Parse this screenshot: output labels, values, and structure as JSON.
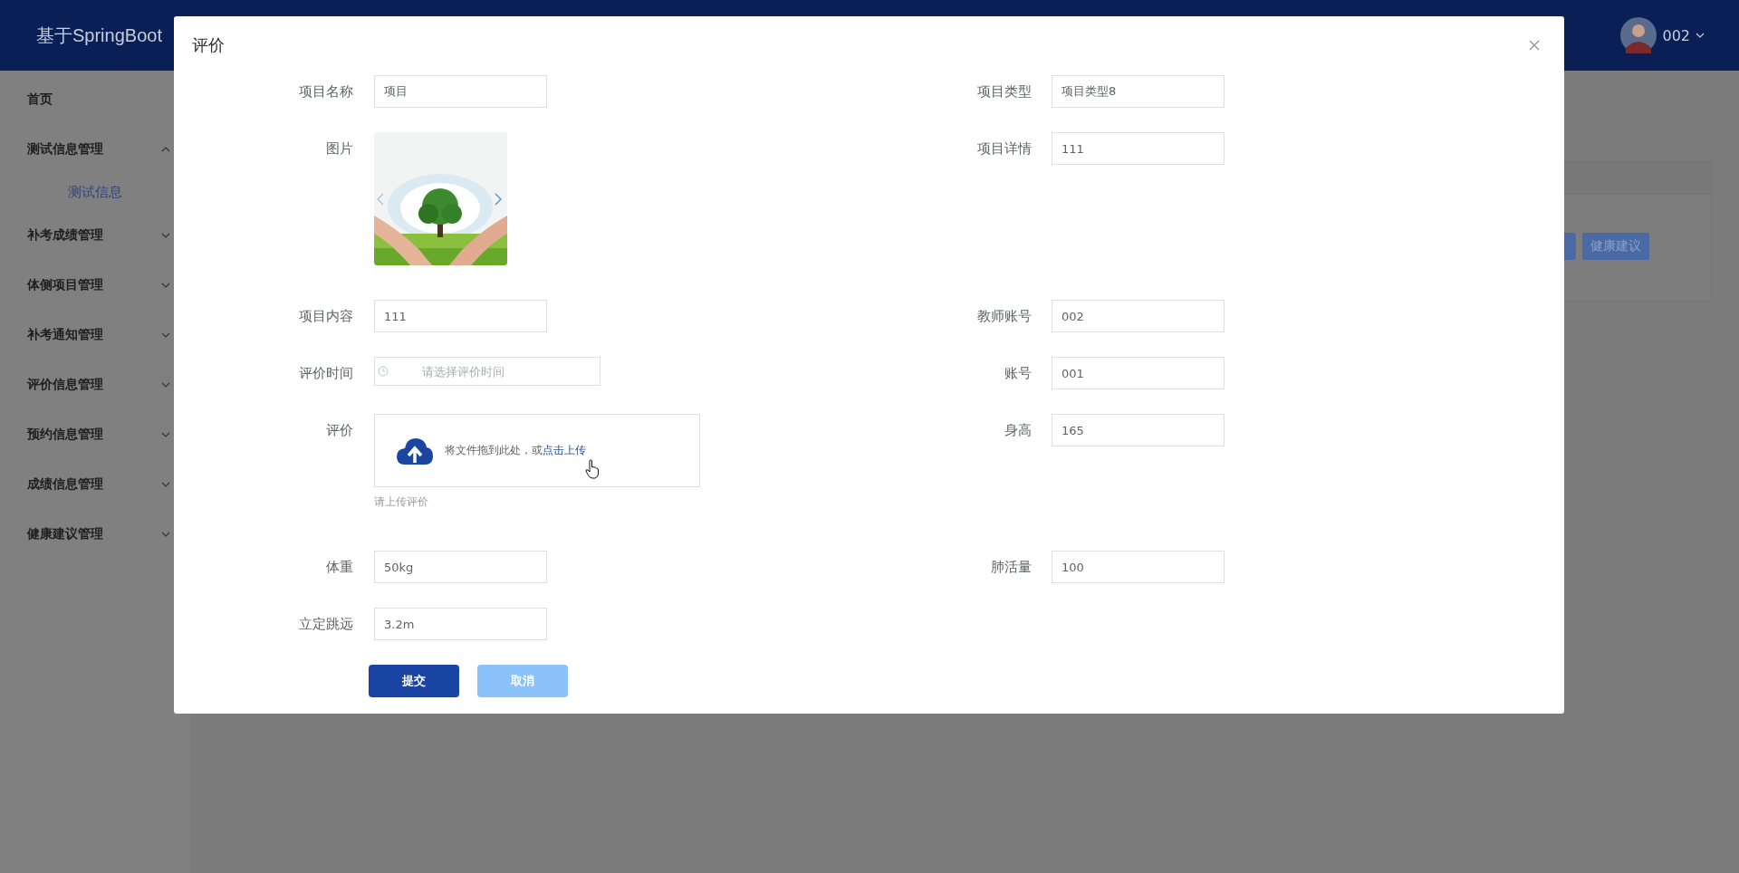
{
  "header": {
    "title": "基于SpringBoot",
    "user": "002"
  },
  "sidebar": {
    "items": [
      {
        "label": "首页",
        "kind": "link"
      },
      {
        "label": "测试信息管理",
        "kind": "group",
        "expanded": true,
        "children": [
          {
            "label": "测试信息",
            "selected": true
          }
        ]
      },
      {
        "label": "补考成绩管理",
        "kind": "group",
        "expanded": false
      },
      {
        "label": "体侧项目管理",
        "kind": "group",
        "expanded": false
      },
      {
        "label": "补考通知管理",
        "kind": "group",
        "expanded": false
      },
      {
        "label": "评价信息管理",
        "kind": "group",
        "expanded": false
      },
      {
        "label": "预约信息管理",
        "kind": "group",
        "expanded": false
      },
      {
        "label": "成绩信息管理",
        "kind": "group",
        "expanded": false
      },
      {
        "label": "健康建议管理",
        "kind": "group",
        "expanded": false
      }
    ]
  },
  "background": {
    "buttons": [
      {
        "kind": "partial"
      },
      {
        "kind": "full",
        "label": "健康建议"
      }
    ]
  },
  "dialog": {
    "title": "评价",
    "rows": [
      {
        "left": {
          "kind": "text",
          "label": "项目名称",
          "value": "项目"
        },
        "right": {
          "kind": "text",
          "label": "项目类型",
          "value": "项目类型8"
        }
      },
      {
        "left": {
          "kind": "picture",
          "label": "图片"
        },
        "right": {
          "kind": "text",
          "label": "项目详情",
          "value": "111"
        }
      },
      {
        "left": {
          "kind": "text",
          "label": "项目内容",
          "value": "111"
        },
        "right": {
          "kind": "text",
          "label": "教师账号",
          "value": "002"
        }
      },
      {
        "left": {
          "kind": "date",
          "label": "评价时间",
          "placeholder": "请选择评价时间"
        },
        "right": {
          "kind": "text",
          "label": "账号",
          "value": "001"
        }
      },
      {
        "left": {
          "kind": "upload",
          "label": "评价",
          "prompt": "将文件拖到此处，或",
          "link": "点击上传",
          "hint": "请上传评价"
        },
        "right": {
          "kind": "text",
          "label": "身高",
          "value": "165"
        }
      },
      {
        "left": {
          "kind": "text",
          "label": "体重",
          "value": "50kg"
        },
        "right": {
          "kind": "text",
          "label": "肺活量",
          "value": "100"
        }
      },
      {
        "left": {
          "kind": "text",
          "label": "立定跳远",
          "value": "3.2m"
        }
      }
    ],
    "buttons": [
      {
        "label": "提交",
        "kind": "primary"
      },
      {
        "label": "取消",
        "kind": "secondary"
      }
    ]
  }
}
